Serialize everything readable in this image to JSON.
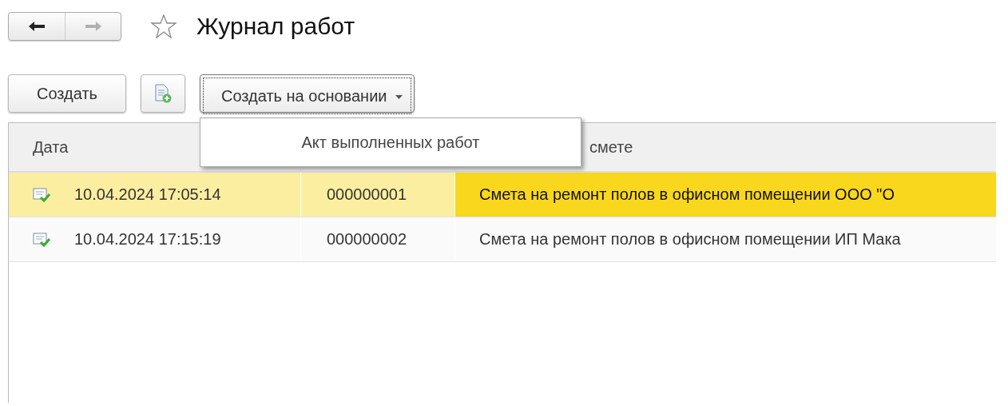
{
  "window": {
    "title": "Журнал работ",
    "favorite": false
  },
  "nav": [
    {
      "kind": "back",
      "disabled": false
    },
    {
      "kind": "forward",
      "disabled": true
    }
  ],
  "toolbar": {
    "create": "Создать",
    "create_based_on": "Создать на основании"
  },
  "dropdown_menu": {
    "items": [
      "Акт выполненных работ"
    ]
  },
  "table": {
    "columns": [
      "Дата",
      "",
      "смете"
    ],
    "rows": [
      {
        "selected": true,
        "posted": true,
        "cells": [
          "10.04.2024 17:05:14",
          "000000001",
          "Смета на ремонт полов в офисном помещении ООО \"О"
        ]
      },
      {
        "selected": false,
        "posted": true,
        "cells": [
          "10.04.2024 17:15:19",
          "000000002",
          "Смета на ремонт полов в офисном помещении ИП Мака"
        ]
      }
    ]
  }
}
